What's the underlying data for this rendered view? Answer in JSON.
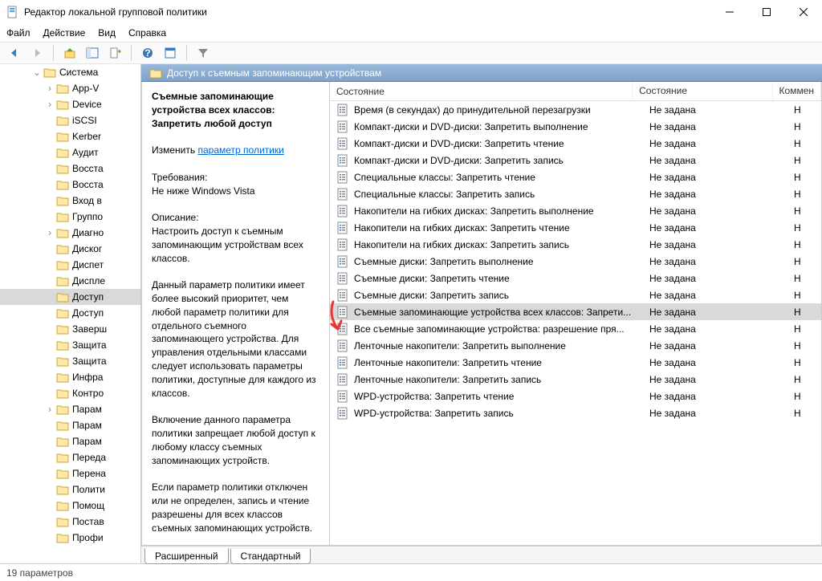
{
  "title": "Редактор локальной групповой политики",
  "menu": [
    "Файл",
    "Действие",
    "Вид",
    "Справка"
  ],
  "tree": {
    "root": {
      "label": "Система",
      "expanded": true
    },
    "items": [
      {
        "label": "App-V",
        "expand": true,
        "indent": 1
      },
      {
        "label": "Device",
        "expand": true,
        "indent": 1
      },
      {
        "label": "iSCSI",
        "expand": false,
        "indent": 1
      },
      {
        "label": "Kerber",
        "expand": false,
        "indent": 1
      },
      {
        "label": "Аудит",
        "expand": false,
        "indent": 1
      },
      {
        "label": "Восста",
        "expand": false,
        "indent": 1
      },
      {
        "label": "Восста",
        "expand": false,
        "indent": 1
      },
      {
        "label": "Вход в",
        "expand": false,
        "indent": 1
      },
      {
        "label": "Группо",
        "expand": false,
        "indent": 1
      },
      {
        "label": "Диагно",
        "expand": true,
        "indent": 1
      },
      {
        "label": "Диског",
        "expand": false,
        "indent": 1
      },
      {
        "label": "Диспет",
        "expand": false,
        "indent": 1
      },
      {
        "label": "Диспле",
        "expand": false,
        "indent": 1
      },
      {
        "label": "Доступ",
        "expand": false,
        "indent": 1,
        "selected": true
      },
      {
        "label": "Доступ",
        "expand": false,
        "indent": 1
      },
      {
        "label": "Заверш",
        "expand": false,
        "indent": 1
      },
      {
        "label": "Защита",
        "expand": false,
        "indent": 1
      },
      {
        "label": "Защита",
        "expand": false,
        "indent": 1
      },
      {
        "label": "Инфра",
        "expand": false,
        "indent": 1
      },
      {
        "label": "Контро",
        "expand": false,
        "indent": 1
      },
      {
        "label": "Парам",
        "expand": true,
        "indent": 1
      },
      {
        "label": "Парам",
        "expand": false,
        "indent": 1
      },
      {
        "label": "Парам",
        "expand": false,
        "indent": 1
      },
      {
        "label": "Переда",
        "expand": false,
        "indent": 1
      },
      {
        "label": "Перена",
        "expand": false,
        "indent": 1
      },
      {
        "label": "Полити",
        "expand": false,
        "indent": 1
      },
      {
        "label": "Помощ",
        "expand": false,
        "indent": 1
      },
      {
        "label": "Постав",
        "expand": false,
        "indent": 1
      },
      {
        "label": "Профи",
        "expand": false,
        "indent": 1
      }
    ]
  },
  "header_path": "Доступ к съемным запоминающим устройствам",
  "desc": {
    "title": "Съемные запоминающие устройства всех классов: Запретить любой доступ",
    "edit_label": "Изменить",
    "edit_link": "параметр политики",
    "req_label": "Требования:",
    "req_text": "Не ниже Windows Vista",
    "desc_label": "Описание:",
    "desc_p1": "Настроить доступ к съемным запоминающим устройствам всех классов.",
    "desc_p2": "Данный параметр политики имеет более высокий приоритет, чем любой параметр политики для отдельного съемного запоминающего устройства. Для управления отдельными классами следует использовать параметры политики, доступные для каждого из классов.",
    "desc_p3": "Включение данного параметра политики запрещает любой доступ к любому классу съемных запоминающих устройств.",
    "desc_p4": "Если параметр политики отключен или не определен, запись и чтение разрешены для всех классов съемных запоминающих устройств."
  },
  "columns": {
    "name": "Состояние",
    "state": "Состояние",
    "comment": "Коммен"
  },
  "state_val": "Не задана",
  "comment_val": "Н",
  "policies": [
    "Время (в секундах) до принудительной перезагрузки",
    "Компакт-диски и DVD-диски: Запретить выполнение",
    "Компакт-диски и DVD-диски: Запретить чтение",
    "Компакт-диски и DVD-диски: Запретить запись",
    "Специальные классы: Запретить чтение",
    "Специальные классы: Запретить запись",
    "Накопители на гибких дисках: Запретить выполнение",
    "Накопители на гибких дисках: Запретить чтение",
    "Накопители на гибких дисках: Запретить запись",
    "Съемные диски: Запретить выполнение",
    "Съемные диски: Запретить чтение",
    "Съемные диски: Запретить запись",
    "Съемные запоминающие устройства всех классов: Запрети...",
    "Все съемные запоминающие устройства: разрешение пря...",
    "Ленточные накопители: Запретить выполнение",
    "Ленточные накопители: Запретить чтение",
    "Ленточные накопители: Запретить запись",
    "WPD-устройства: Запретить чтение",
    "WPD-устройства: Запретить запись"
  ],
  "selected_policy": 12,
  "tabs": {
    "extended": "Расширенный",
    "standard": "Стандартный"
  },
  "status": "19 параметров"
}
